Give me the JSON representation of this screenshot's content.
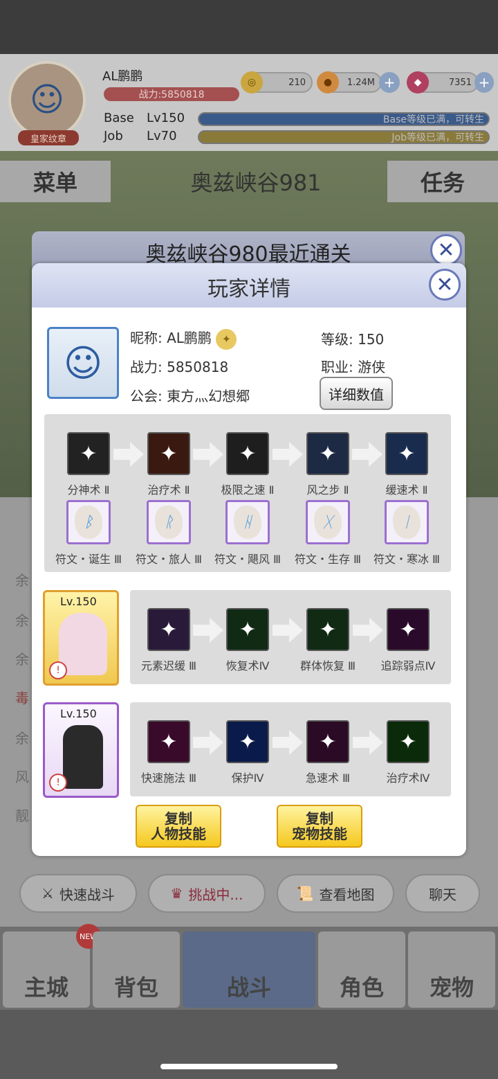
{
  "header": {
    "player_name": "AL鹏鹏",
    "power": "战力:5850818",
    "badge": "皇家纹章",
    "resources": [
      {
        "icon": "coin-icon",
        "value": "210"
      },
      {
        "icon": "zeny-icon",
        "value": "1.24M"
      },
      {
        "icon": "gem-icon",
        "value": "7351"
      }
    ],
    "base_label": "Base",
    "base_level": "Lv150",
    "base_bar_text": "Base等级已满，可转生",
    "job_label": "Job",
    "job_level": "Lv70",
    "job_bar_text": "Job等级已满，可转生"
  },
  "banner": {
    "menu": "菜单",
    "map": "奥兹峡谷981",
    "task": "任务"
  },
  "behind_dialog": {
    "title": "奥兹峡谷980最近通关"
  },
  "dialog": {
    "title": "玩家详情",
    "nickname_label": "昵称:",
    "nickname": "AL鹏鹏",
    "power_label": "战力:",
    "power": "5850818",
    "guild_label": "公会:",
    "guild": "東方灬幻想郷",
    "level_label": "等级:",
    "level": "150",
    "job_label": "职业:",
    "job": "游侠",
    "detail_button": "详细数值",
    "skills": [
      {
        "name": "分神术 Ⅱ",
        "icon": "distract-icon",
        "color": "#222222"
      },
      {
        "name": "治疗术 Ⅱ",
        "icon": "heal-heart-icon",
        "color": "#3a1a10"
      },
      {
        "name": "极限之速 Ⅱ",
        "icon": "sprint-icon",
        "color": "#1e1e1e"
      },
      {
        "name": "风之步 Ⅱ",
        "icon": "wind-step-icon",
        "color": "#1d2a44"
      },
      {
        "name": "缓速术 Ⅱ",
        "icon": "slow-icon",
        "color": "#1a2c4e"
      }
    ],
    "runes": [
      {
        "name": "符文・诞生 Ⅲ",
        "glyph": "ᛒ"
      },
      {
        "name": "符文・旅人 Ⅲ",
        "glyph": "ᚱ"
      },
      {
        "name": "符文・飓风 Ⅲ",
        "glyph": "ᚺ"
      },
      {
        "name": "符文・生存 Ⅲ",
        "glyph": "ᚷ"
      },
      {
        "name": "符文・寒冰 Ⅲ",
        "glyph": "ᛁ"
      }
    ],
    "pets": [
      {
        "level": "Lv.150",
        "skills": [
          {
            "name": "元素迟缓 Ⅲ",
            "icon": "element-cube-icon",
            "color": "#2a1a3a"
          },
          {
            "name": "恢复术Ⅳ",
            "icon": "recover-icon",
            "color": "#102a14"
          },
          {
            "name": "群体恢复 Ⅲ",
            "icon": "group-recover-icon",
            "color": "#102a14"
          },
          {
            "name": "追踪弱点Ⅳ",
            "icon": "weakpoint-icon",
            "color": "#2a0a2a"
          }
        ]
      },
      {
        "level": "Lv.150",
        "skills": [
          {
            "name": "快速施法 Ⅲ",
            "icon": "clock-icon",
            "color": "#3a0a2a"
          },
          {
            "name": "保护Ⅳ",
            "icon": "shield-icon",
            "color": "#0a1a4a"
          },
          {
            "name": "急速术 Ⅲ",
            "icon": "haste-icon",
            "color": "#2a0a24"
          },
          {
            "name": "治疗术Ⅳ",
            "icon": "heal-icon",
            "color": "#0a2a0a"
          }
        ]
      }
    ],
    "copy_char_line1": "复制",
    "copy_char_line2": "人物技能",
    "copy_pet_line1": "复制",
    "copy_pet_line2": "宠物技能"
  },
  "bottom": {
    "quick_battle": "快速战斗",
    "challenge": "挑战中...",
    "view_map": "查看地图",
    "chat": "聊天",
    "nav": [
      "主城",
      "背包",
      "战斗",
      "角色",
      "宠物"
    ],
    "new_badge": "NEW"
  }
}
